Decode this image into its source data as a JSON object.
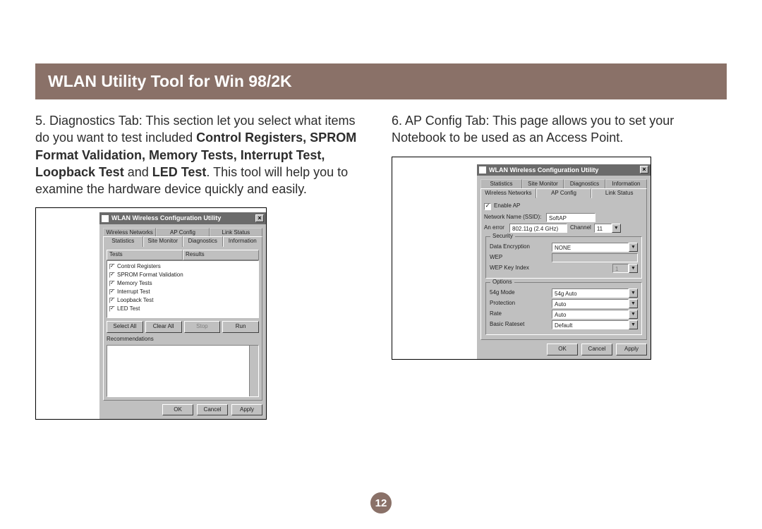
{
  "page": {
    "title": "WLAN Utility Tool for Win 98/2K",
    "page_number": "12"
  },
  "left": {
    "num": "5.",
    "pre": " Diagnostics Tab: This section let you select what items do you want to test included ",
    "bold": "Control Registers, SPROM Format Validation, Memory Tests, Interrupt Test, Loopback Test",
    "mid": " and ",
    "bold2": "LED Test",
    "post": ". This tool will help you to examine the hardware device quickly and easily."
  },
  "right": {
    "num": "6.",
    "text": " AP Config Tab: This page allows you to set your Notebook to be used as an Access Point."
  },
  "win1": {
    "title": "WLAN Wireless Configuration Utility",
    "tabs_back": [
      "Wireless Networks",
      "AP Config",
      "Link Status"
    ],
    "tabs_front": [
      "Statistics",
      "Site Monitor",
      "Diagnostics",
      "Information"
    ],
    "active_tab": "Diagnostics",
    "list_headers": [
      "Tests",
      "Results"
    ],
    "tests": [
      "Control Registers",
      "SPROM Format Validation",
      "Memory Tests",
      "Interrupt Test",
      "Loopback Test",
      "LED  Test"
    ],
    "buttons": {
      "select_all": "Select All",
      "clear_all": "Clear All",
      "stop": "Stop",
      "run": "Run"
    },
    "rec_label": "Recommendations",
    "bottom": {
      "ok": "OK",
      "cancel": "Cancel",
      "apply": "Apply"
    }
  },
  "win2": {
    "title": "WLAN Wireless Configuration Utility",
    "tabs_back": [
      "Statistics",
      "Site Monitor",
      "Diagnostics",
      "Information"
    ],
    "tabs_front": [
      "Wireless Networks",
      "AP Config",
      "Link Status"
    ],
    "active_tab": "AP Config",
    "enable_ap": "Enable AP",
    "ssid_label": "Network Name (SSID):",
    "ssid_value": "SoftAP",
    "row2_label": "An error",
    "row2_value": "802.11g (2.4 GHz)",
    "channel_label": "Channel",
    "channel_value": "11",
    "security": {
      "legend": "Security",
      "enc_label": "Data Encryption",
      "enc_value": "NONE",
      "wep_label": "WEP",
      "wepidx_label": "WEP Key Index",
      "wepidx_value": "1"
    },
    "options": {
      "legend": "Options",
      "mode_label": "54g Mode",
      "mode_value": "54g Auto",
      "prot_label": "Protection",
      "prot_value": "Auto",
      "rate_label": "Rate",
      "rate_value": "Auto",
      "basic_label": "Basic Rateset",
      "basic_value": "Default"
    },
    "bottom": {
      "ok": "OK",
      "cancel": "Cancel",
      "apply": "Apply"
    }
  }
}
